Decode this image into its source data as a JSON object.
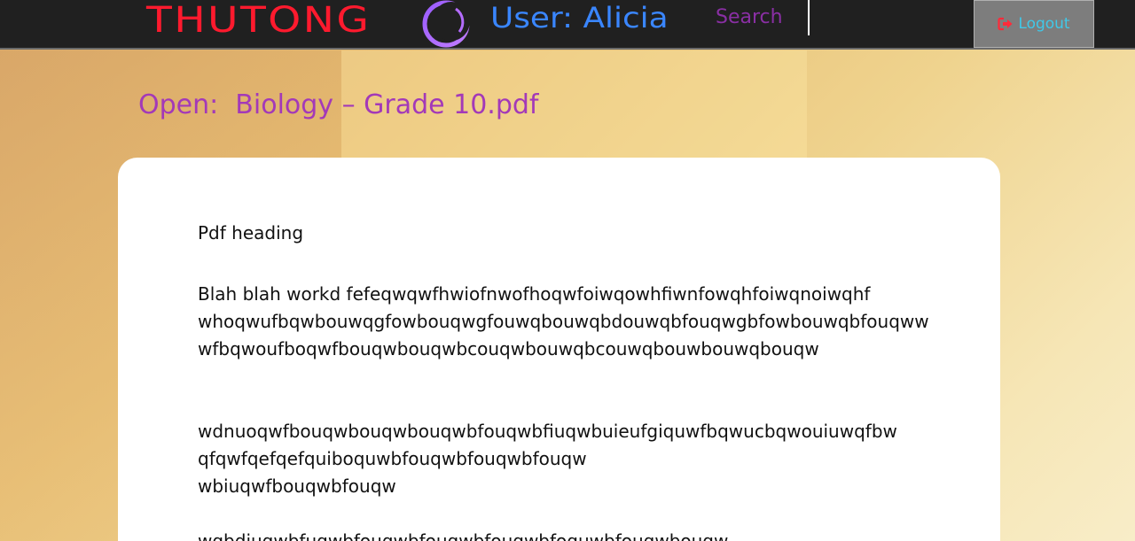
{
  "header": {
    "brand": "THUTONG",
    "user_label": "User: Alicia",
    "search_placeholder": "Search",
    "logout_label": "Logout",
    "logo_icon": "crescent-ring-logo",
    "logout_icon": "sign-out-icon"
  },
  "page": {
    "title": "Open:  Biology – Grade 10.pdf"
  },
  "document": {
    "heading": "Pdf heading",
    "paragraphs": [
      "Blah blah workd fefeqwqwfhwiofnwofhoqwfoiwqowhfiwnfowqhfoiwqnoiwqhf\nwhoqwufbqwbouwqgfowbouqwgfouwqbouwqbdouwqbfouqwgbfowbouwqbfouqww\nwfbqwoufboqwfbouqwbouqwbcouqwbouwqbcouwqbouwbouwqbouqw",
      "wdnuoqwfbouqwbouqwbouqwbfouqwbfiuqwbuieufgiquwfbqwucbqwouiuwqfbw\nqfqwfqefqefquiboquwbfouqwbfouqwbfouqw\nwbiuqwfbouqwbfouqw",
      "wqbdiuqwbfuqwbfouqwbfouqwbfouqwbfoquwbfouqwbouqw"
    ]
  },
  "colors": {
    "brand": "#ff1a2e",
    "user": "#3a86ff",
    "accent": "#a339b8",
    "topbar": "#202020",
    "logout_text": "#40c8e8",
    "logout_icon": "#ff2a3a"
  }
}
